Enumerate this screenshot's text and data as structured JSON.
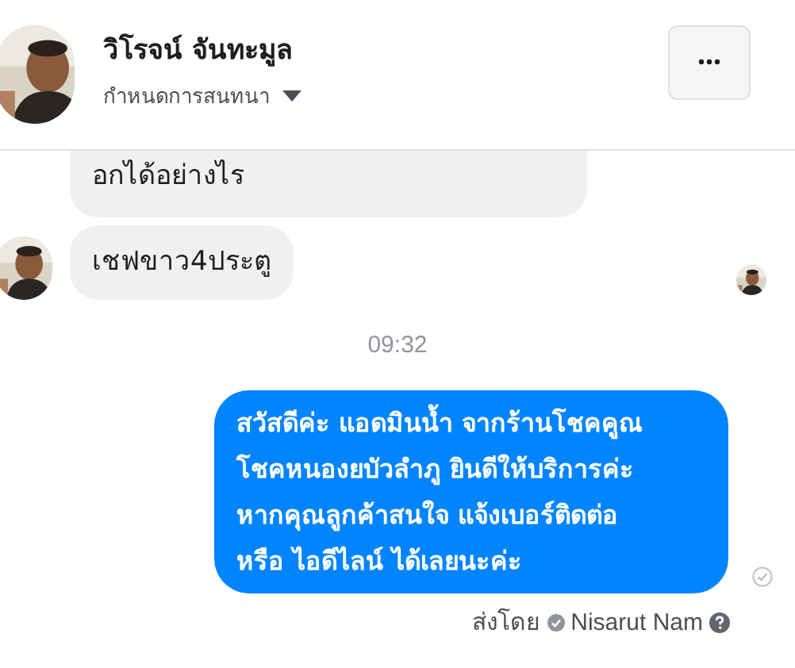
{
  "header": {
    "name": "วิโรจน์ จันทะมูล",
    "subtitle": "กำหนดการสนทนา"
  },
  "messages": [
    {
      "kind": "incoming",
      "text": "อกได้อย่างไร",
      "avatar": false
    },
    {
      "kind": "incoming",
      "text": "เชฟขาว4ประตู",
      "avatar": true,
      "seen": true
    },
    {
      "kind": "time",
      "text": "09:32"
    },
    {
      "kind": "outgoing",
      "text": "สวัสดีค่ะ แอดมินน้ำ จากร้านโชคคูณ โชคหนองยบัวลำภู ยินดีให้บริการค่ะ หากคุณลูกค้าสนใจ แจ้งเบอร์ติดต่อ หรือ ไอดีไลน์ ได้เลยนะค่ะ",
      "delivered": true
    }
  ],
  "sent_by": {
    "label": "ส่งโดย",
    "name": "Nisarut Nam"
  }
}
